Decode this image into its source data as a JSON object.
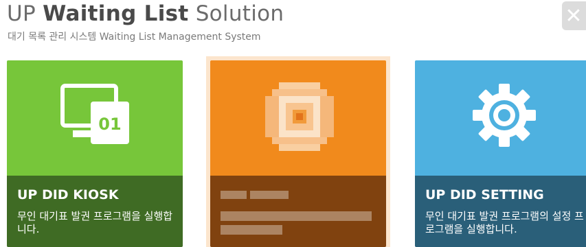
{
  "header": {
    "title_prefix": "UP",
    "title_bold": "Waiting List",
    "title_suffix": "Solution",
    "subtitle": "대기 목록 관리 시스템 Waiting List Management System"
  },
  "close_button": {
    "symbol": "✕"
  },
  "tiles": [
    {
      "name": "UP DID KIOSK",
      "description": "무인 대기표 발권 프로그램을 실행합니다.",
      "icon": "monitor-icon",
      "icon_text": "01",
      "color_top": "#77c63a",
      "color_bottom": "#3f6b24"
    },
    {
      "name": "",
      "description": "",
      "icon": "pixelated-icon",
      "color_top": "#f18a1c",
      "color_bottom": "#80420f"
    },
    {
      "name": "UP DID SETTING",
      "description": "무인 대기표 발권 프로그램의 설정 프로그램을 실행합니다.",
      "icon": "gear-icon",
      "color_top": "#4eb1e0",
      "color_bottom": "#2a5f79"
    }
  ]
}
